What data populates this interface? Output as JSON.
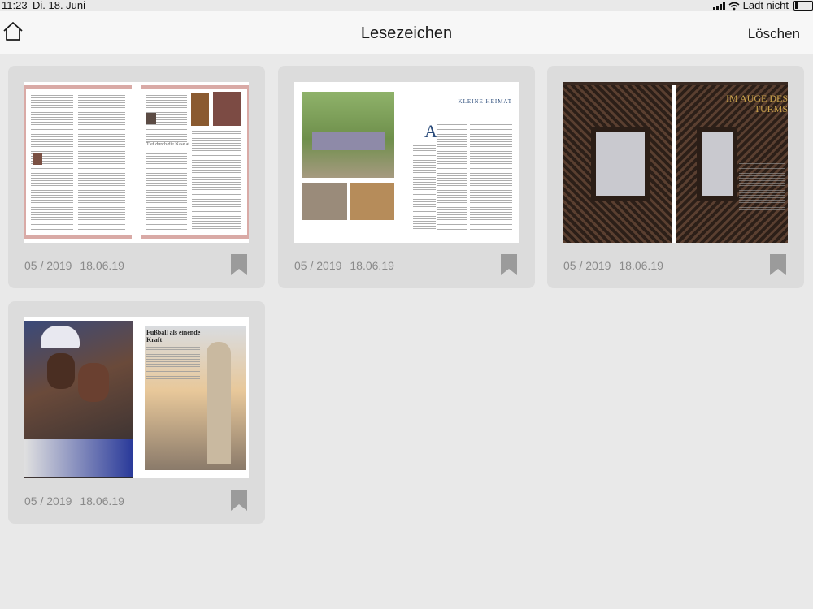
{
  "status": {
    "time": "11:23",
    "date": "Di. 18. Juni",
    "charging": "Lädt nicht"
  },
  "nav": {
    "title": "Lesezeichen",
    "delete_label": "Löschen"
  },
  "bookmarks": [
    {
      "issue": "05 / 2019",
      "date": "18.06.19",
      "page_title": "Tief durch die Nase atmen"
    },
    {
      "issue": "05 / 2019",
      "date": "18.06.19",
      "page_title": "KLEINE HEIMAT"
    },
    {
      "issue": "05 / 2019",
      "date": "18.06.19",
      "page_title": "IM AUGE DES TURMS"
    },
    {
      "issue": "05 / 2019",
      "date": "18.06.19",
      "page_title": "Fußball als einende Kraft"
    }
  ],
  "colors": {
    "background": "#e9e9e9",
    "card": "#dcdcdc",
    "meta_text": "#8a8a8a",
    "bookmark_icon": "#9b9b9b",
    "accent_gold": "#c9a24a"
  }
}
